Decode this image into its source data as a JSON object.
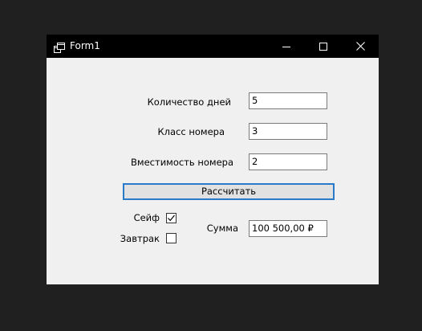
{
  "window": {
    "title": "Form1"
  },
  "form": {
    "days": {
      "label": "Количество дней",
      "value": "5"
    },
    "room_class": {
      "label": "Класс номера",
      "value": "3"
    },
    "capacity": {
      "label": "Вместимость номера",
      "value": "2"
    },
    "calculate_label": "Рассчитать",
    "safe": {
      "label": "Сейф",
      "checked": true
    },
    "breakfast": {
      "label": "Завтрак",
      "checked": false
    },
    "sum": {
      "label": "Сумма",
      "value": "100 500,00 ₽"
    }
  },
  "colors": {
    "titlebar": "#000000",
    "client_area": "#f0f0f0",
    "button_focus_border": "#2a7acb",
    "desktop": "#202020"
  },
  "icons": {
    "app": "window-app-icon",
    "minimize": "minimize-icon",
    "maximize": "maximize-icon",
    "close": "close-icon",
    "check": "checkmark-icon"
  }
}
